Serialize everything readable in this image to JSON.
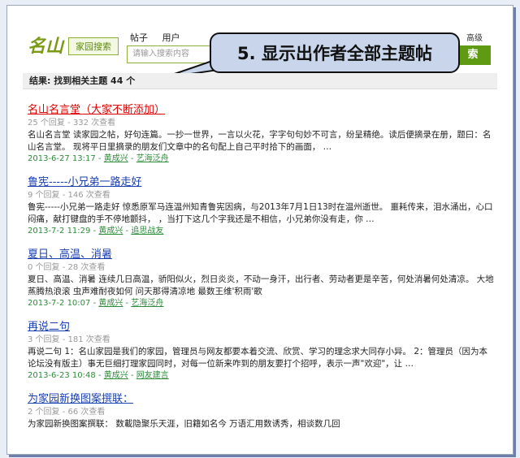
{
  "header": {
    "logo_mark": "名山",
    "logo_sub": "家园搜索",
    "tabs": [
      "帖子",
      "用户"
    ],
    "search_placeholder": "请输入搜索内容",
    "search_button": "索",
    "advanced": "高级"
  },
  "callout": {
    "text": "5. 显示出作者全部主题帖"
  },
  "result_summary": "结果: 找到相关主题 44 个",
  "results": [
    {
      "title": "名山名言堂（大家不断添加）",
      "meta": "25 个回复 - 332 次查看",
      "snippet": "名山名言堂 读家园之帖，好句连篇。一抄一世界，一言以火花，字字句句妙不可言，纷呈精绝。读后便摘录在册，题曰：名山名言堂。 现将平日里摘录的朋友们文章中的名句配上自己平时拾下的画面， …",
      "date": "2013-6-27 13:17",
      "author": "黄成兴",
      "forum": "艺海泛舟"
    },
    {
      "title": "鲁宪-----小兄弟一路走好",
      "meta": "9 个回复 - 146 次查看",
      "snippet": "鲁宪-----小兄弟一路走好 惊悉原军马连温州知青鲁宪因病，与2013年7月1日13时在温州逝世。 噩耗传来，泪水涌出，心口闷痛，献打键盘的手不停地颤抖， ，当打下这几个字我还是不相信，小兄弟你没有走，你 …",
      "date": "2013-7-2 11:29",
      "author": "黄成兴",
      "forum": "追思战友"
    },
    {
      "title": "夏日、高温、消暑",
      "meta": "0 个回复 - 28 次查看",
      "snippet": "夏日、高温、消暑 连续几日高温，骄阳似火，烈日炎炎，不动一身汗，出行者、劳动者更是辛苦，何处消暑何处清凉。 大地蒸腾热浪滚 虫声难耐夜如何 问天那得清凉地 最数王维'积雨'歌",
      "date": "2013-7-2 10:07",
      "author": "黄成兴",
      "forum": "艺海泛舟"
    },
    {
      "title": "再说二句",
      "meta": "3 个回复 - 181 次查看",
      "snippet": "再说二句 1：名山家园是我们的家园，管理员与网友都要本着交流、欣赏、学习的理念求大同存小异。 2：管理员（因为本论坛没有版主）事无巨细打理家园同时，对每一位新来咋到的朋友要打个招呼，表示一声\"欢迎\"，让 …",
      "date": "2013-6-23 10:48",
      "author": "黄成兴",
      "forum": "网友建言"
    },
    {
      "title": "为家园新换图案撰联：",
      "meta": "2 个回复 - 66 次查看",
      "snippet": "为家园新换图案撰联： 数載隐聚乐天涯，旧籍如名今 万语汇用数诱秀，相谈数几回",
      "date": "",
      "author": "",
      "forum": ""
    }
  ]
}
